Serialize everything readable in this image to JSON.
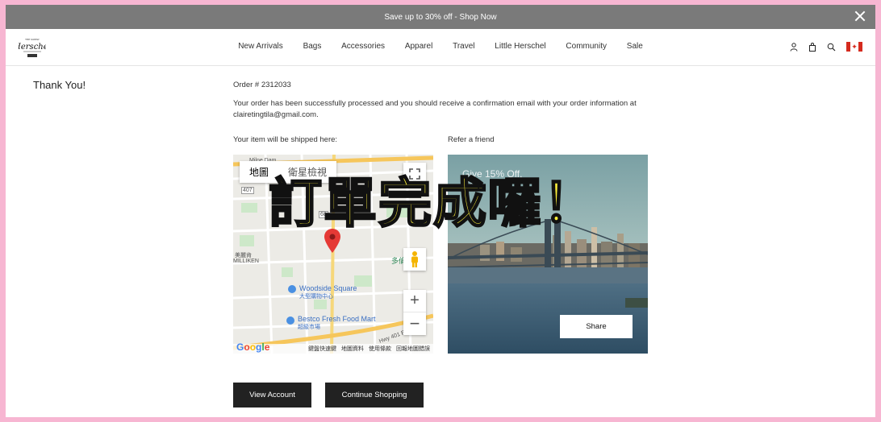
{
  "promo_bar": {
    "text": "Save up to 30% off - Shop Now"
  },
  "header": {
    "logo": "Herschel",
    "nav": [
      "New Arrivals",
      "Bags",
      "Accessories",
      "Apparel",
      "Travel",
      "Little Herschel",
      "Community",
      "Sale"
    ],
    "icons": [
      "account-icon",
      "bag-icon",
      "search-icon",
      "canada-flag-icon"
    ]
  },
  "confirmation": {
    "heading": "Thank You!",
    "order_number": "Order # 2312033",
    "message": "Your order has been successfully processed and you should receive a confirmation email with your order information at clairetingtila@gmail.com.",
    "shipping_label": "Your item will be shipped here:",
    "refer_label": "Refer a friend"
  },
  "map": {
    "tab_map": "地圖",
    "tab_satellite": "衛星檢視",
    "labels": {
      "milne_dam": "Milne Dam",
      "route_407": "407",
      "route_68": "68",
      "milliken": "MILLIKEN",
      "milliken_cn": "美麗肯",
      "woodside": "Woodside Square",
      "woodside_cn": "大型購物中心",
      "bestco": "Bestco Fresh Food Mart",
      "bestco_cn": "超級市場",
      "side_cn": "多倫",
      "highway": "Hwy 401 Exp"
    },
    "footer": [
      "鍵盤快速鍵",
      "地圖資料",
      "使用條款",
      "回報地圖錯誤"
    ],
    "google": "Google"
  },
  "refer": {
    "promo_line1": "Give 15% Off,",
    "promo_line2": "Get",
    "share_label": "Share"
  },
  "buttons": {
    "view_account": "View Account",
    "continue_shopping": "Continue Shopping"
  },
  "overlay_text": "訂單完成囉！",
  "colors": {
    "background_border": "#f7b6d2",
    "promo_bar": "#7a7a7a",
    "button": "#222222",
    "overlay_fill": "#fff23a"
  }
}
